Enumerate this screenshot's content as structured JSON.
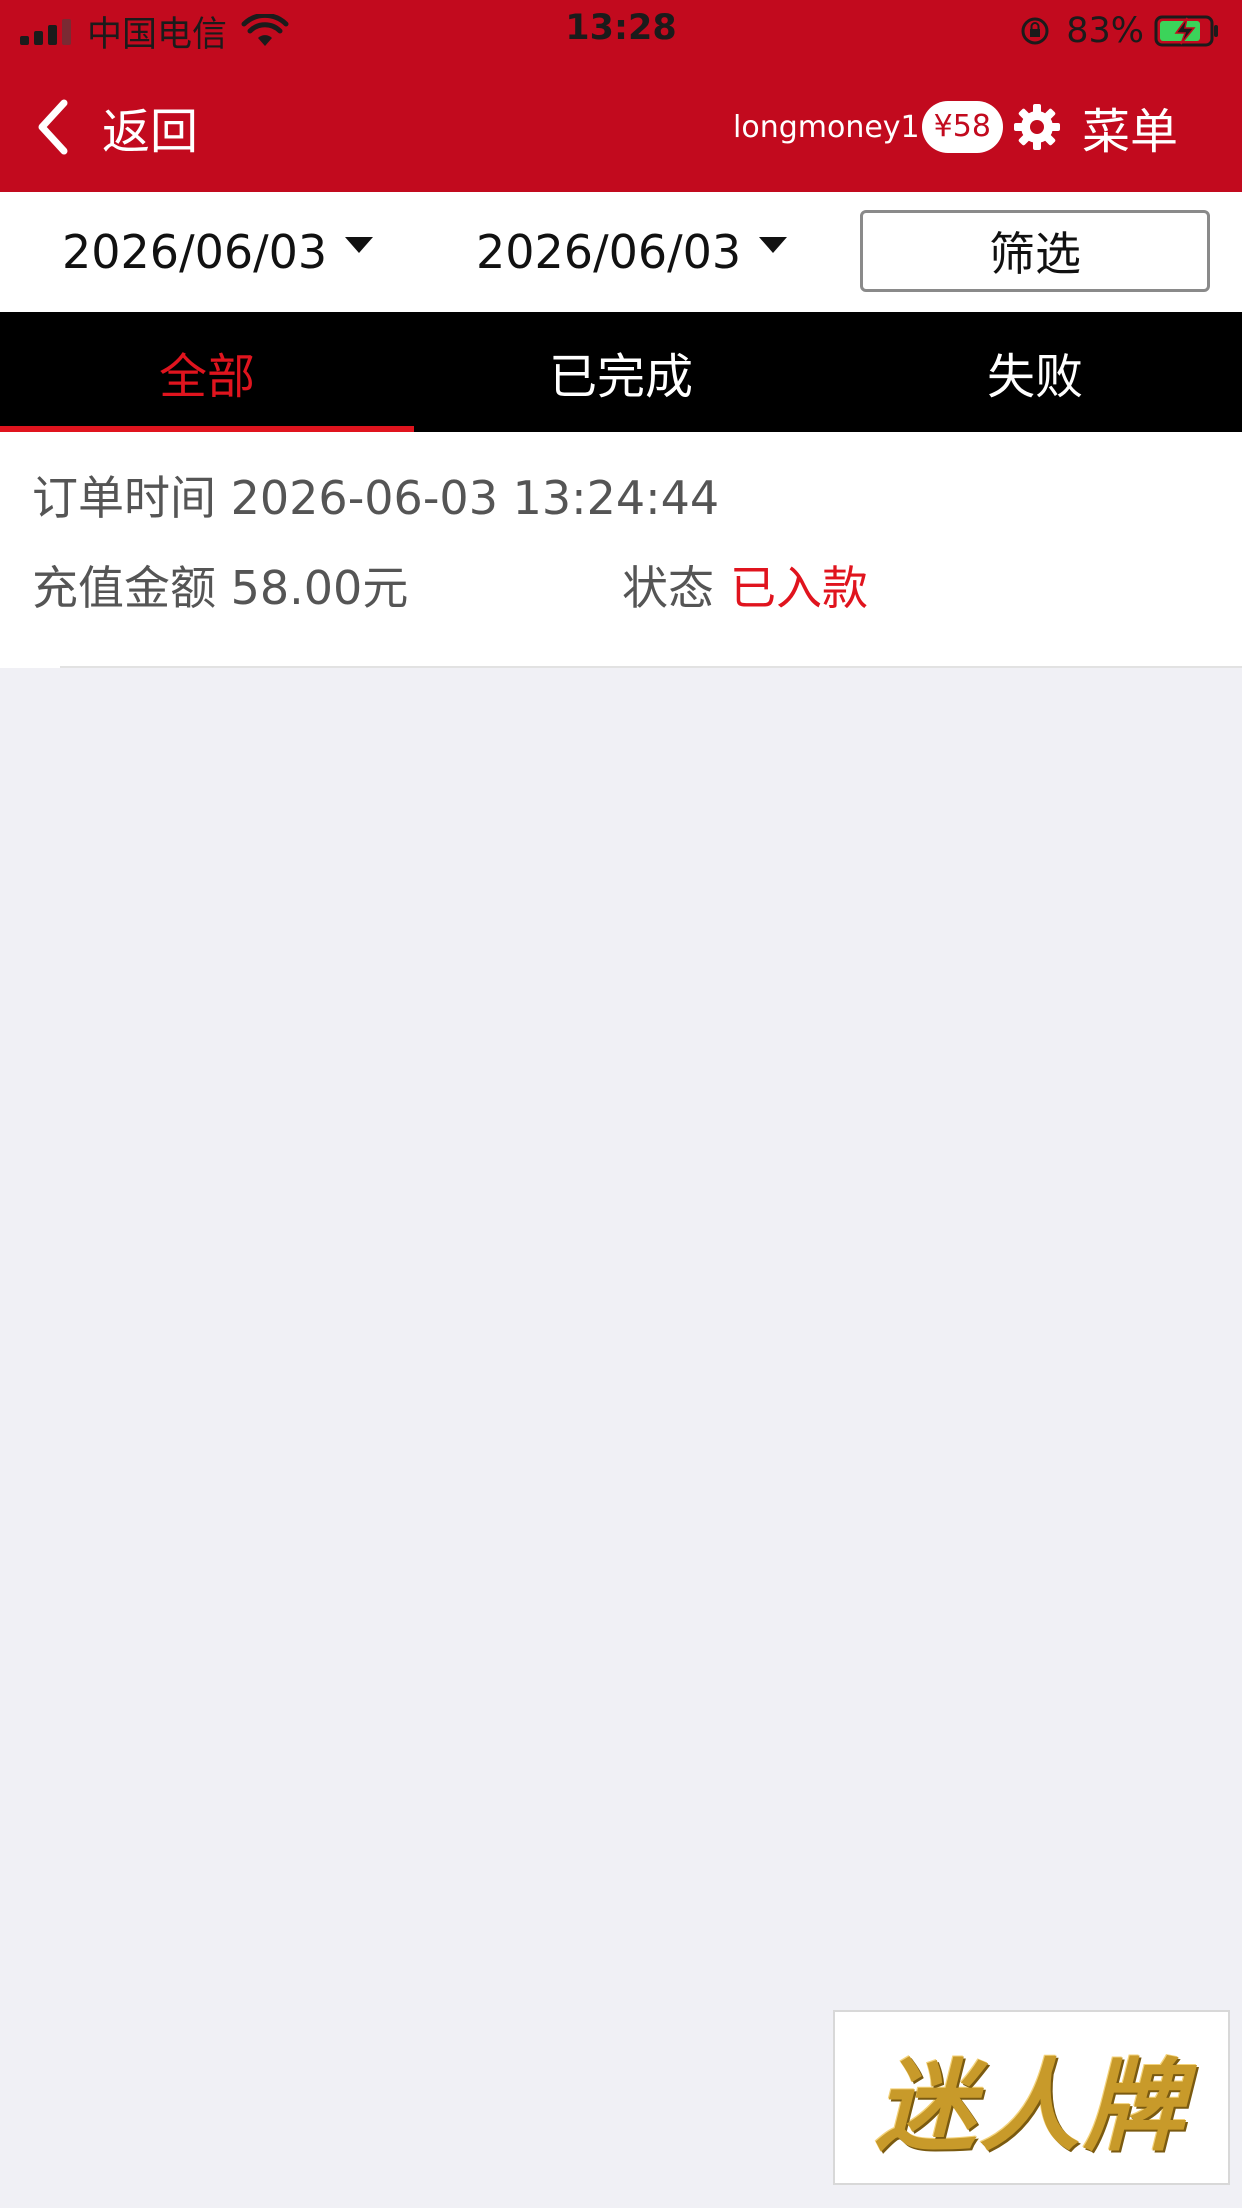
{
  "status_bar": {
    "carrier": "中国电信",
    "time": "13:28",
    "battery_percent": "83%",
    "signal_icon": "signal-icon",
    "wifi_icon": "wifi-icon",
    "battery_icon": "battery-charging-icon"
  },
  "header": {
    "back_label": "返回",
    "username": "longmoney1",
    "balance": "¥58",
    "menu_label": "菜单",
    "bg_color": "#c20a1e"
  },
  "filter": {
    "start_date": "2026/06/03",
    "end_date": "2026/06/03",
    "button_label": "筛选"
  },
  "tabs": [
    {
      "label": "全部",
      "active": true
    },
    {
      "label": "已完成",
      "active": false
    },
    {
      "label": "失败",
      "active": false
    }
  ],
  "records": [
    {
      "time_label": "订单时间",
      "time_value": "2026-06-03 13:24:44",
      "amount_label": "充值金额",
      "amount_value": "58.00元",
      "status_label": "状态",
      "status_value": "已入款"
    }
  ],
  "logo": {
    "text": "迷人牌"
  },
  "colors": {
    "accent_red": "#e0141e",
    "tab_bar": "#000000",
    "page_bg": "#f0f0f5"
  }
}
